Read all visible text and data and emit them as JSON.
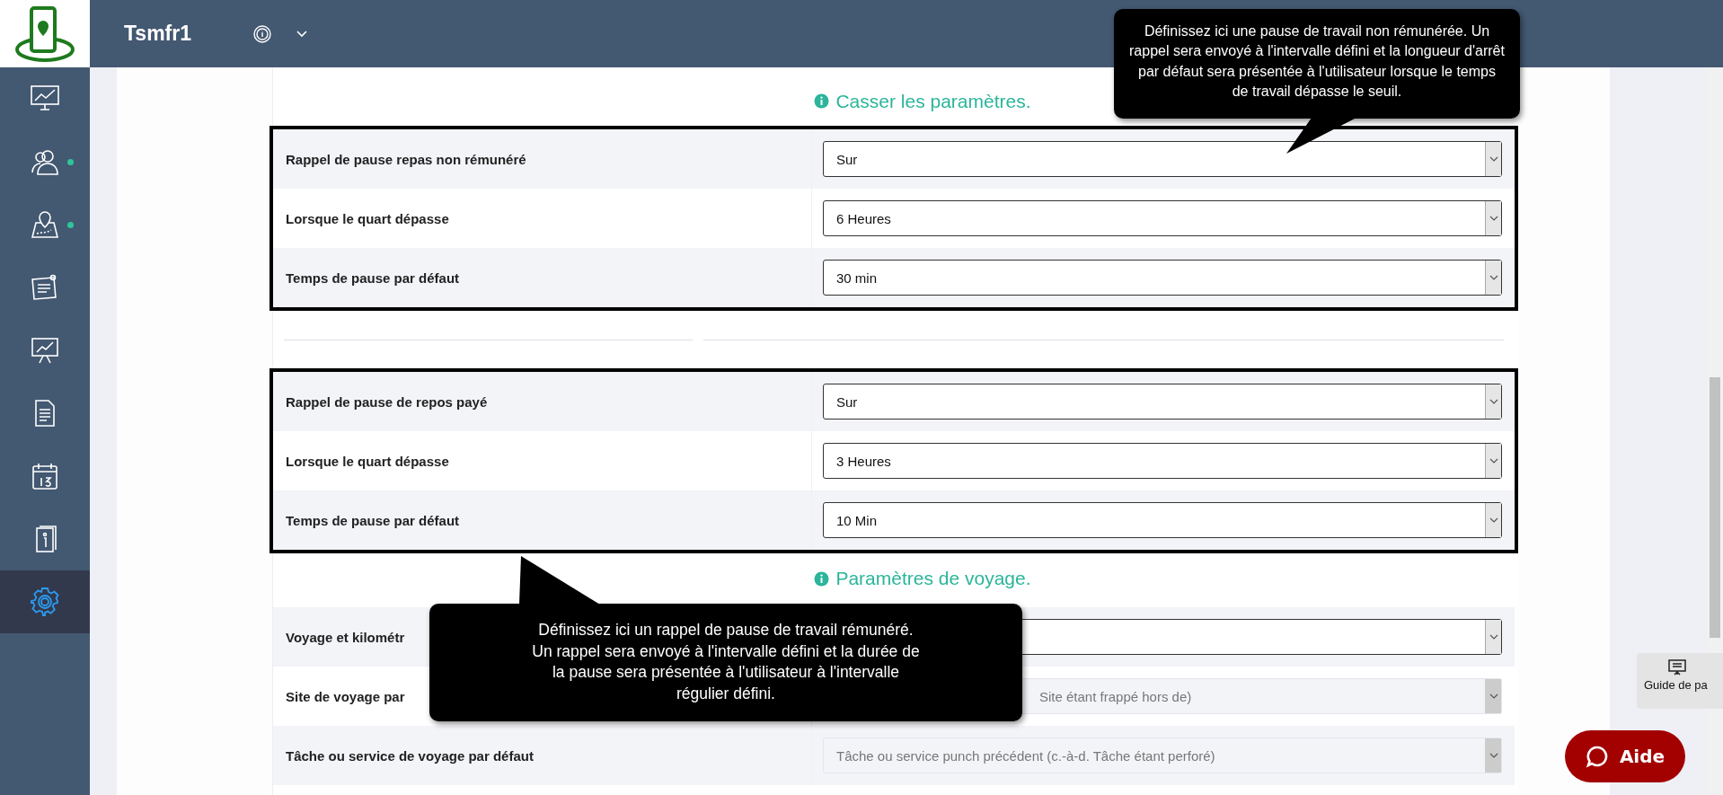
{
  "topbar": {
    "title": "Tsmfr1"
  },
  "sidebar": {
    "items": [
      {
        "selected": false,
        "dot": false
      },
      {
        "selected": false,
        "dot": true
      },
      {
        "selected": false,
        "dot": true
      },
      {
        "selected": false,
        "dot": false
      },
      {
        "selected": false,
        "dot": false
      },
      {
        "selected": false,
        "dot": false
      },
      {
        "selected": false,
        "dot": false
      },
      {
        "selected": false,
        "dot": false
      },
      {
        "selected": true,
        "dot": false
      }
    ]
  },
  "sections": [
    {
      "heading": "Casser les paramètres.",
      "groups": [
        {
          "highlighted": true,
          "rows": [
            {
              "label": "Rappel de pause repas non rémunéré",
              "value": "Sur",
              "disabled": false
            },
            {
              "label": "Lorsque le quart dépasse",
              "value": "6 Heures",
              "disabled": false
            },
            {
              "label": "Temps de pause par défaut",
              "value": "30 min",
              "disabled": false
            }
          ]
        },
        {
          "highlighted": true,
          "rows": [
            {
              "label": "Rappel de pause de repos payé",
              "value": "Sur",
              "disabled": false
            },
            {
              "label": "Lorsque le quart dépasse",
              "value": "3 Heures",
              "disabled": false
            },
            {
              "label": "Temps de pause par défaut",
              "value": "10 Min",
              "disabled": false
            }
          ]
        }
      ]
    },
    {
      "heading": "Paramètres de voyage.",
      "groups": [
        {
          "highlighted": false,
          "rows": [
            {
              "label": "Voyage et kilométr",
              "disabled": false
            },
            {
              "label": "Site de voyage par",
              "value": "Site étant frappé hors de)",
              "disabled": true
            },
            {
              "label": "Tâche ou service de voyage par défaut",
              "value": "Tâche ou service punch précédent (c.-à-d. Tâche étant perforé)",
              "disabled": true
            }
          ]
        }
      ]
    }
  ],
  "tooltips": [
    {
      "text": "Définissez ici une pause de travail non rémunérée. Un rappel sera envoyé à l'intervalle défini et la longueur d'arrêt par défaut sera présentée à l'utilisateur lorsque le temps de travail dépasse le seuil."
    },
    {
      "text": "Définissez ici un rappel de pause de travail rémunéré. Un rappel sera envoyé à l'intervalle défini et la durée de la pause sera présentée à l'utilisateur à l'intervalle régulier défini."
    }
  ],
  "guide_button": {
    "label": "Guide de pa"
  },
  "help_button": {
    "label": "Aide"
  }
}
